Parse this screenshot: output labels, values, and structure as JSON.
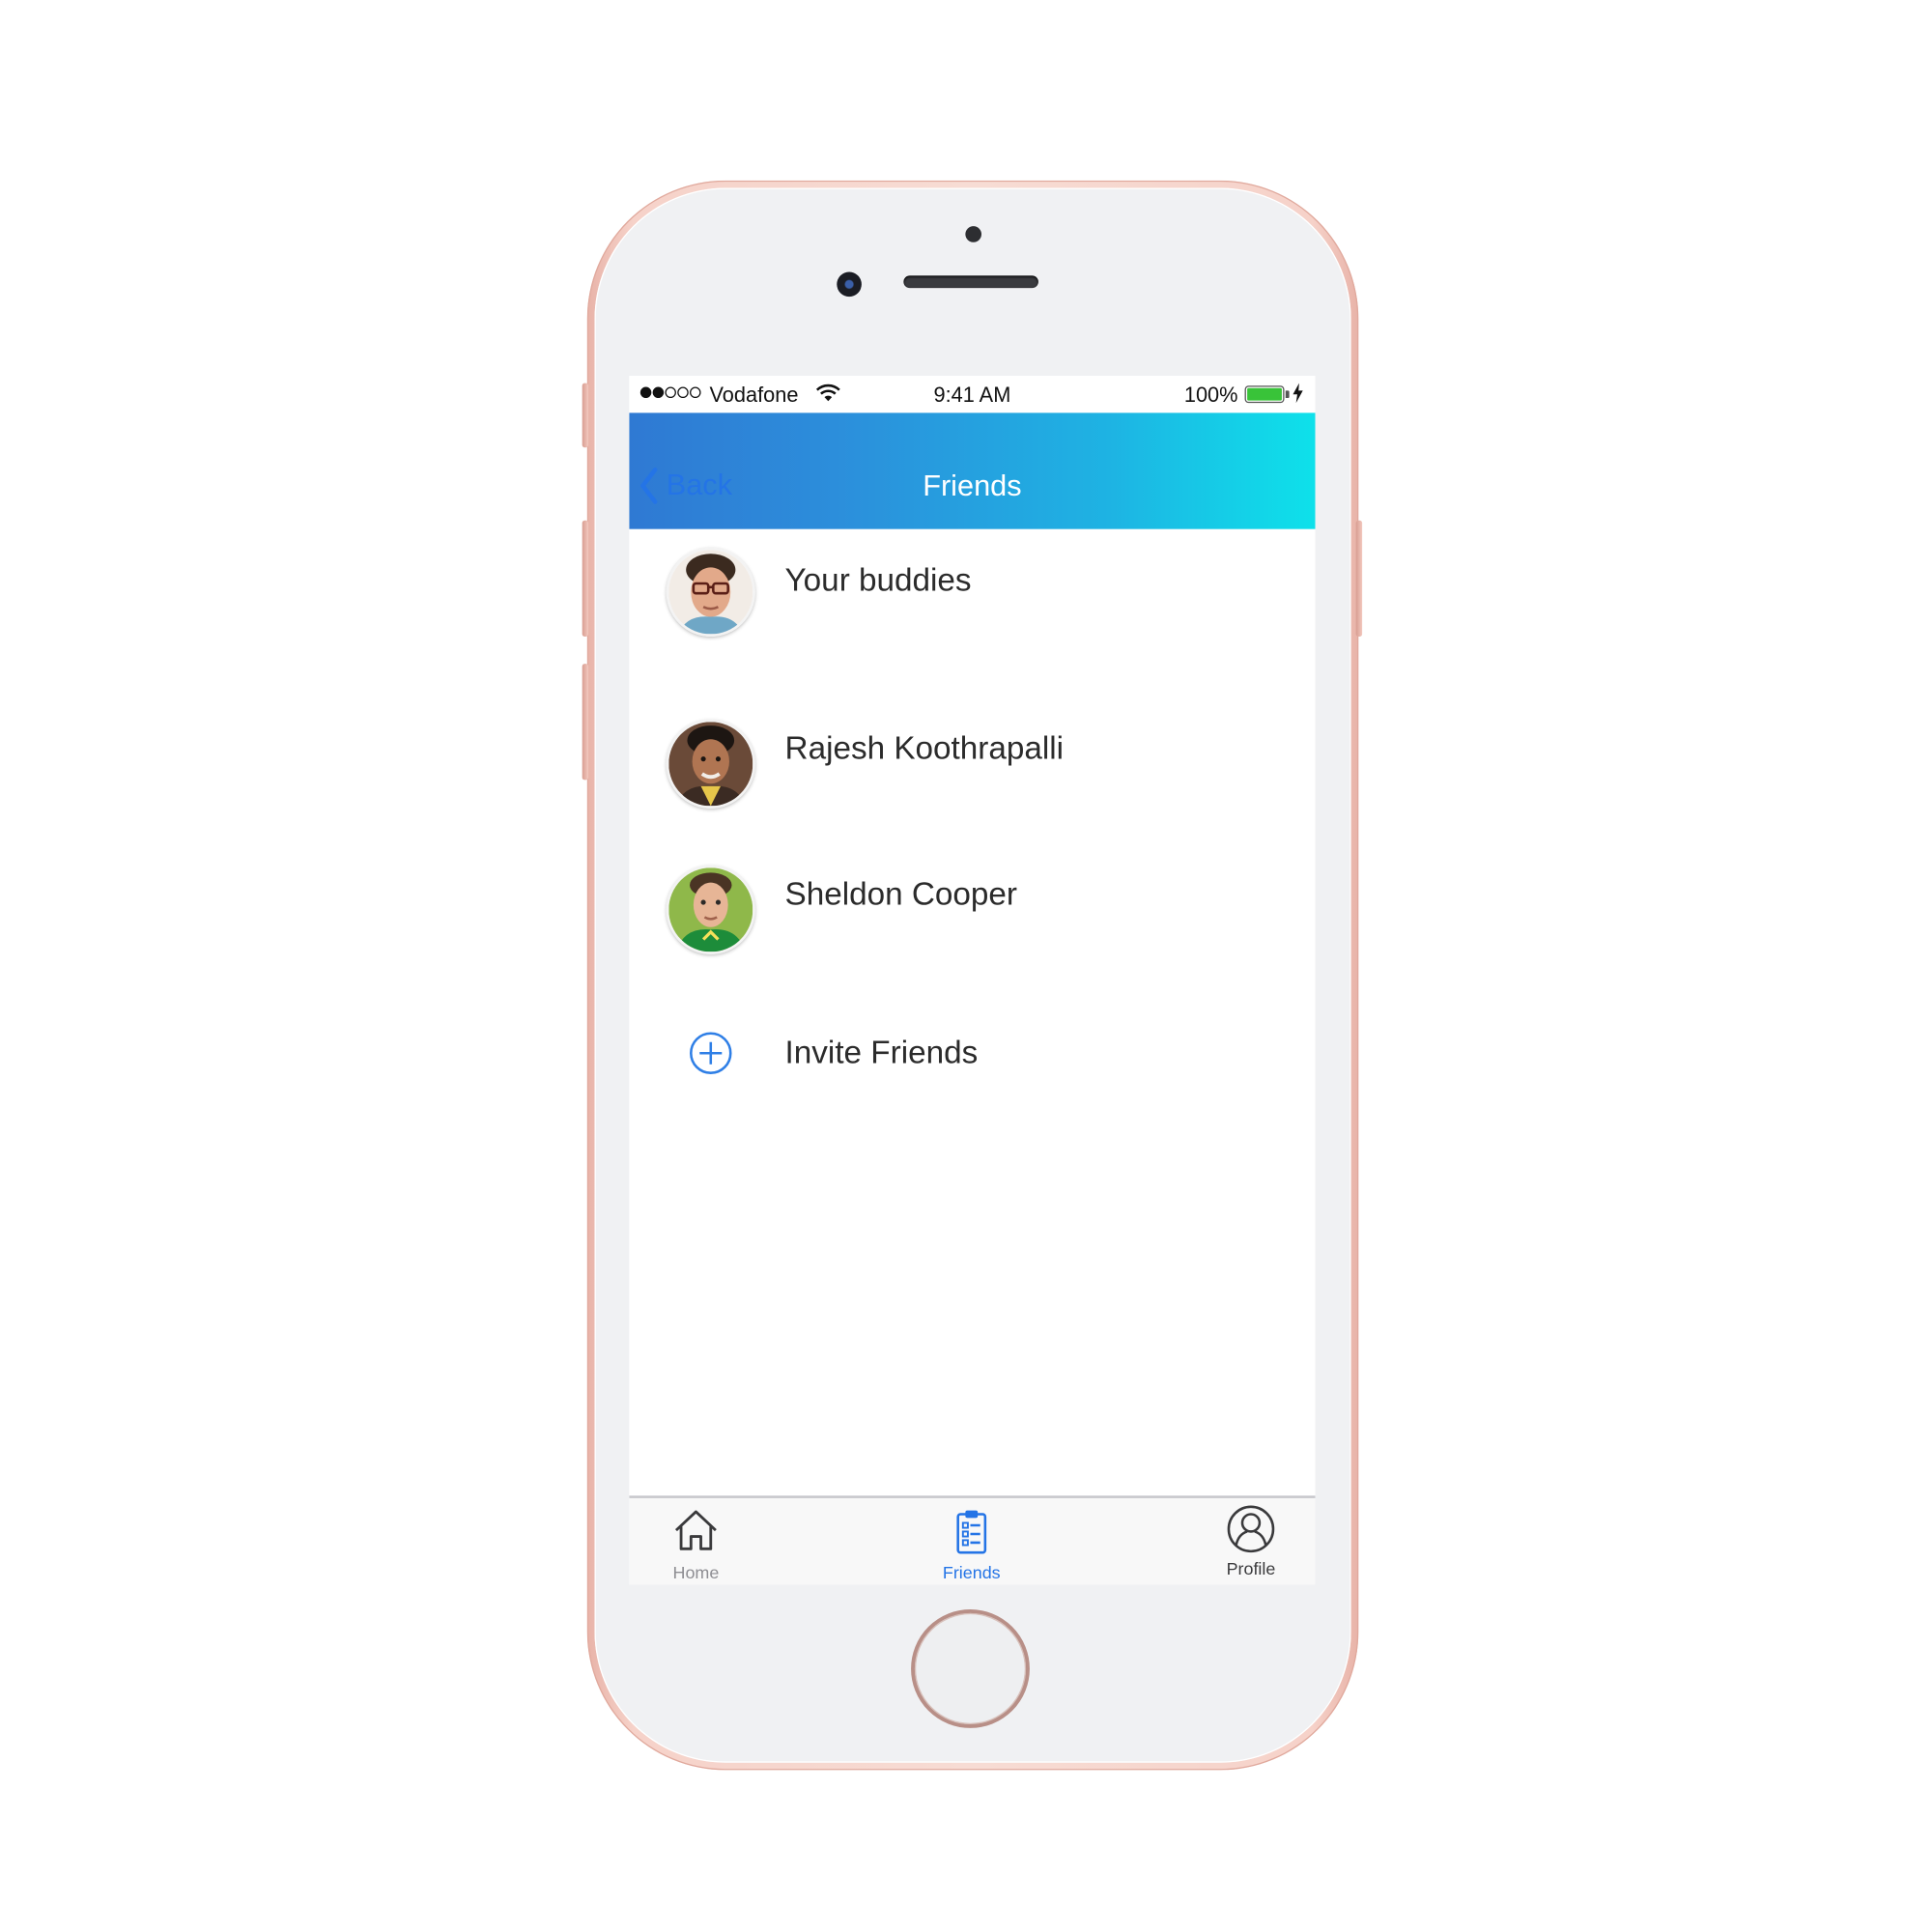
{
  "status_bar": {
    "carrier": "Vodafone",
    "time": "9:41 AM",
    "battery": "100%",
    "signal_bars_filled": 2,
    "signal_bars_total": 5,
    "battery_level": 1.0,
    "battery_color": "#39c339"
  },
  "nav": {
    "back_label": "Back",
    "title": "Friends",
    "gradient_start": "#2f79d3",
    "gradient_end": "#0ee1ea"
  },
  "list": {
    "items": [
      {
        "label": "Your buddies",
        "avatar": "leonard-avatar"
      },
      {
        "label": "Rajesh Koothrapalli",
        "avatar": "rajesh-avatar"
      },
      {
        "label": "Sheldon Cooper",
        "avatar": "sheldon-avatar"
      }
    ],
    "invite_label": "Invite Friends",
    "invite_icon": "plus-circle-icon"
  },
  "tab_bar": {
    "tabs": [
      {
        "label": "Home",
        "icon": "home-icon",
        "active": false
      },
      {
        "label": "Friends",
        "icon": "clipboard-list-icon",
        "active": true
      },
      {
        "label": "Profile",
        "icon": "user-circle-icon",
        "active": false
      }
    ],
    "active_color": "#2474e6",
    "inactive_color": "#8e8e93"
  }
}
